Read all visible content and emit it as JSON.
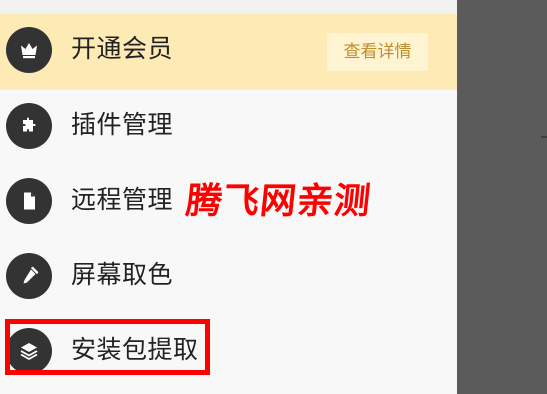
{
  "menu": {
    "items": [
      {
        "icon": "crown-icon",
        "label": "开通会员",
        "action_label": "查看详情"
      },
      {
        "icon": "puzzle-icon",
        "label": "插件管理"
      },
      {
        "icon": "document-icon",
        "label": "远程管理"
      },
      {
        "icon": "eyedropper-icon",
        "label": "屏幕取色"
      },
      {
        "icon": "layers-icon",
        "label": "安装包提取"
      }
    ]
  },
  "watermark": {
    "text": "腾飞网亲测"
  },
  "colors": {
    "vip_background": "#fdeab5",
    "vip_button_background": "#fff4d2",
    "vip_button_text": "#c08d2f",
    "icon_circle": "#333333",
    "watermark": "#ff0000",
    "highlight": "#ff0000",
    "overlay": "#5b5b5b"
  }
}
